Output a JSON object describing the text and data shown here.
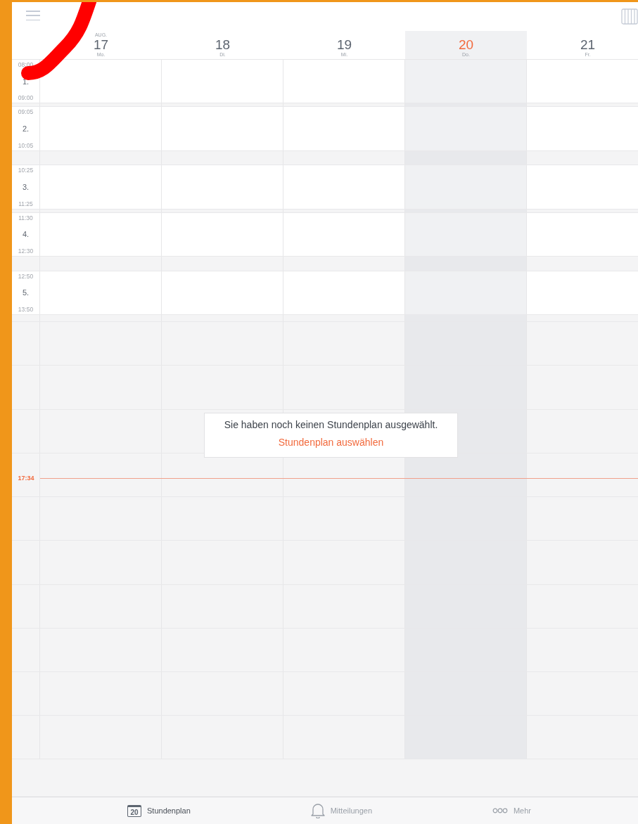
{
  "days": [
    {
      "month": "AUG.",
      "number": "17",
      "weekday": "Mo.",
      "today": false
    },
    {
      "number": "18",
      "weekday": "Di.",
      "today": false
    },
    {
      "number": "19",
      "weekday": "Mi.",
      "today": false
    },
    {
      "number": "20",
      "weekday": "Do.",
      "today": true
    },
    {
      "number": "21",
      "weekday": "Fr.",
      "today": false
    }
  ],
  "periods": [
    {
      "label": "1.",
      "start": "08:00",
      "end": "09:00"
    },
    {
      "label": "2.",
      "start": "09:05",
      "end": "10:05"
    },
    {
      "label": "3.",
      "start": "10:25",
      "end": "11:25"
    },
    {
      "label": "4.",
      "start": "11:30",
      "end": "12:30"
    },
    {
      "label": "5.",
      "start": "12:50",
      "end": "13:50"
    }
  ],
  "now": "17:34",
  "empty_state": {
    "message": "Sie haben noch keinen Stundenplan ausgewählt.",
    "action": "Stundenplan auswählen"
  },
  "tabs": [
    {
      "kind": "calendar",
      "icon_text": "20",
      "label": "Stundenplan",
      "selected": true
    },
    {
      "kind": "bell",
      "label": "Mitteilungen",
      "selected": false
    },
    {
      "kind": "dots",
      "label": "Mehr",
      "selected": false
    }
  ]
}
